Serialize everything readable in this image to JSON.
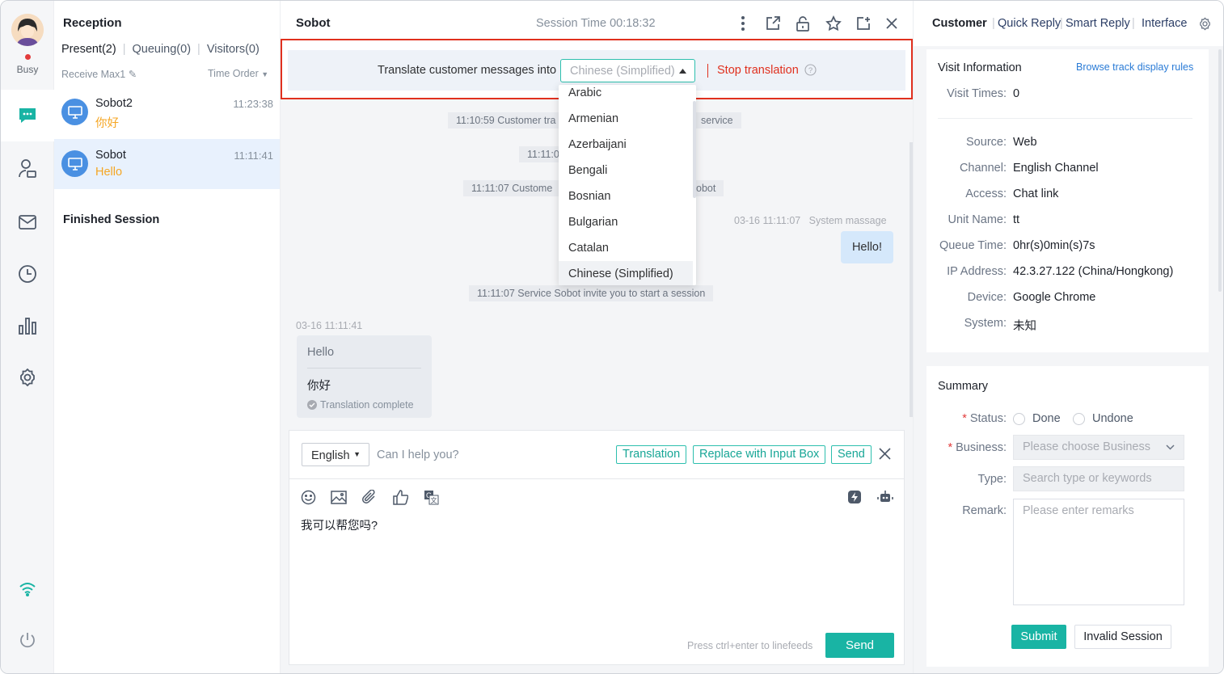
{
  "rail": {
    "status": "Busy"
  },
  "sessions": {
    "title": "Reception",
    "tabs": [
      "Present(2)",
      "Queuing(0)",
      "Visitors(0)"
    ],
    "receive_max": "Receive Max1",
    "time_order": "Time Order",
    "items": [
      {
        "name": "Sobot2",
        "message": "你好",
        "time": "11:23:38"
      },
      {
        "name": "Sobot",
        "message": "Hello",
        "time": "11:11:41"
      }
    ],
    "finished": "Finished Session"
  },
  "chat": {
    "name": "Sobot",
    "session_time": "Session Time 00:18:32",
    "translate_label": "Translate customer messages into",
    "translate_value": "Chinese (Simplified)",
    "stop_translation": "Stop translation",
    "languages": [
      "Arabic",
      "Armenian",
      "Azerbaijani",
      "Bengali",
      "Bosnian",
      "Bulgarian",
      "Catalan",
      "Chinese (Simplified)"
    ],
    "sys1_a": "11:10:59 Customer tra",
    "sys1_b": "service",
    "sys2": "11:11:0",
    "sys3_a": "11:11:07 Custome",
    "sys3_b": "obot",
    "meta_right": "03-16 11:11:07   System massage",
    "bubble_right": "Hello!",
    "sys4": "11:11:07 Service Sobot invite you to start a session",
    "meta_left": "03-16 11:11:41",
    "bubble_left_original": "Hello",
    "bubble_left_translated": "你好",
    "bubble_left_status": "Translation complete",
    "input": {
      "language": "English",
      "placeholder": "Can I help you?",
      "translation_btn": "Translation",
      "replace_btn": "Replace with Input Box",
      "send_small": "Send",
      "text": "我可以帮您吗?",
      "hint": "Press ctrl+enter to linefeeds",
      "send": "Send"
    }
  },
  "right": {
    "tabs": [
      "Customer",
      "Quick Reply",
      "Smart Reply",
      "Interface"
    ],
    "visit_title": "Visit Information",
    "browse_rules": "Browse track display rules",
    "visit_times_k": "Visit Times",
    "visit_times_v": "0",
    "rows": [
      {
        "k": "Source",
        "v": "Web"
      },
      {
        "k": "Channel",
        "v": "English Channel"
      },
      {
        "k": "Access",
        "v": "Chat link"
      },
      {
        "k": "Unit Name",
        "v": "tt"
      },
      {
        "k": "Queue Time",
        "v": "0hr(s)0min(s)7s"
      },
      {
        "k": "IP Address",
        "v": "42.3.27.122 (China/Hongkong)"
      },
      {
        "k": "Device",
        "v": "Google Chrome"
      },
      {
        "k": "System",
        "v": "未知"
      }
    ],
    "summary": "Summary",
    "status_k": "Status",
    "done": "Done",
    "undone": "Undone",
    "business_k": "Business",
    "business_ph": "Please choose Business",
    "type_k": "Type",
    "type_ph": "Search type or keywords",
    "remark_k": "Remark",
    "remark_ph": "Please enter remarks",
    "submit": "Submit",
    "invalid": "Invalid Session"
  }
}
